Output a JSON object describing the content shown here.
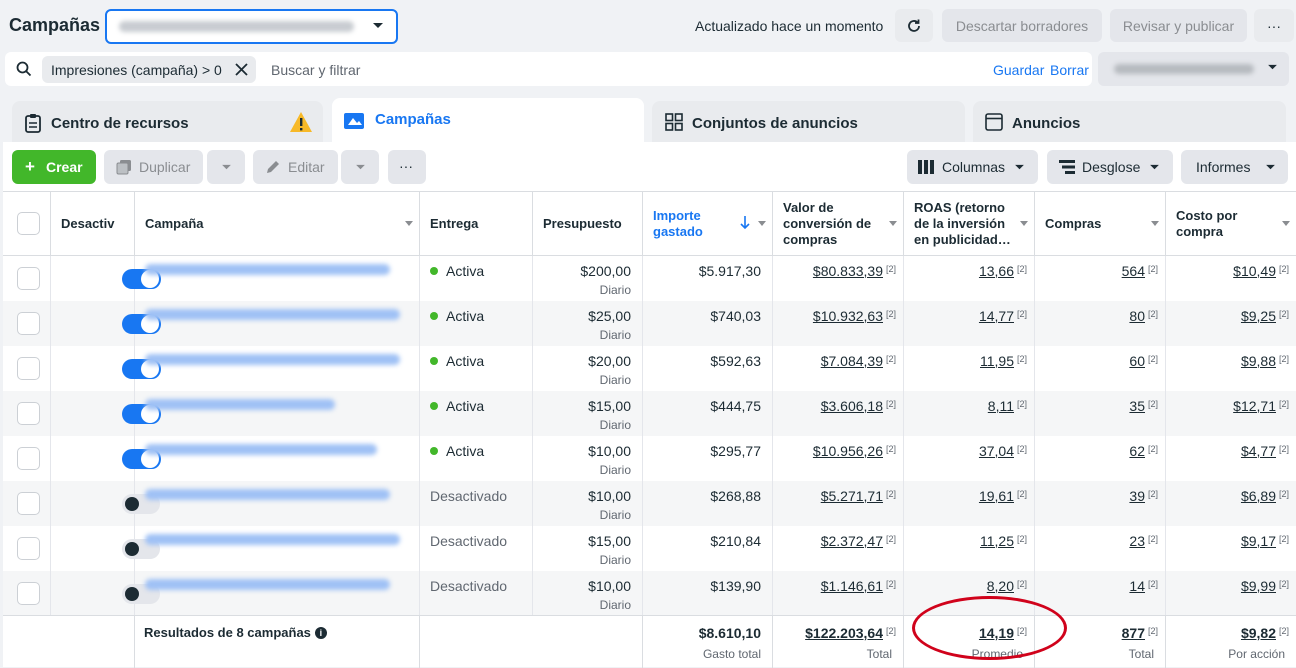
{
  "header": {
    "title": "Campañas",
    "updated": "Actualizado hace un momento",
    "discard_label": "Descartar borradores",
    "review_label": "Revisar y publicar",
    "more_label": "···"
  },
  "filter": {
    "chip": "Impresiones (campaña) > 0",
    "placeholder": "Buscar y filtrar",
    "save": "Guardar",
    "clear": "Borrar"
  },
  "tabs": [
    {
      "label": "Centro de recursos"
    },
    {
      "label": "Campañas"
    },
    {
      "label": "Conjuntos de anuncios"
    },
    {
      "label": "Anuncios"
    }
  ],
  "toolbar": {
    "create": "Crear",
    "duplicate": "Duplicar",
    "edit": "Editar",
    "more": "···",
    "columns": "Columnas",
    "breakdown": "Desglose",
    "reports": "Informes"
  },
  "columns": {
    "toggle": "Desactiv",
    "campaign": "Campaña",
    "delivery": "Entrega",
    "budget": "Presupuesto",
    "spent_1": "Importe",
    "spent_2": "gastado",
    "conv_1": "Valor de",
    "conv_2": "conversión de",
    "conv_3": "compras",
    "roas_1": "ROAS (retorno",
    "roas_2": "de la inversión",
    "roas_3": "en publicidad…",
    "purchases": "Compras",
    "cost_1": "Costo por",
    "cost_2": "compra"
  },
  "note_sup": "[2]",
  "rows": [
    {
      "on": true,
      "delivery": "Activa",
      "budget": "$200,00",
      "budget_sub": "Diario",
      "spent": "$5.917,30",
      "conv": "$80.833,39",
      "roas": "13,66",
      "purchases": "564",
      "cost": "$10,49"
    },
    {
      "on": true,
      "delivery": "Activa",
      "budget": "$25,00",
      "budget_sub": "Diario",
      "spent": "$740,03",
      "conv": "$10.932,63",
      "roas": "14,77",
      "purchases": "80",
      "cost": "$9,25"
    },
    {
      "on": true,
      "delivery": "Activa",
      "budget": "$20,00",
      "budget_sub": "Diario",
      "spent": "$592,63",
      "conv": "$7.084,39",
      "roas": "11,95",
      "purchases": "60",
      "cost": "$9,88"
    },
    {
      "on": true,
      "delivery": "Activa",
      "budget": "$15,00",
      "budget_sub": "Diario",
      "spent": "$444,75",
      "conv": "$3.606,18",
      "roas": "8,11",
      "purchases": "35",
      "cost": "$12,71"
    },
    {
      "on": true,
      "delivery": "Activa",
      "budget": "$10,00",
      "budget_sub": "Diario",
      "spent": "$295,77",
      "conv": "$10.956,26",
      "roas": "37,04",
      "purchases": "62",
      "cost": "$4,77"
    },
    {
      "on": false,
      "delivery": "Desactivado",
      "budget": "$10,00",
      "budget_sub": "Diario",
      "spent": "$268,88",
      "conv": "$5.271,71",
      "roas": "19,61",
      "purchases": "39",
      "cost": "$6,89"
    },
    {
      "on": false,
      "delivery": "Desactivado",
      "budget": "$15,00",
      "budget_sub": "Diario",
      "spent": "$210,84",
      "conv": "$2.372,47",
      "roas": "11,25",
      "purchases": "23",
      "cost": "$9,17"
    },
    {
      "on": false,
      "delivery": "Desactivado",
      "budget": "$10,00",
      "budget_sub": "Diario",
      "spent": "$139,90",
      "conv": "$1.146,61",
      "roas": "8,20",
      "purchases": "14",
      "cost": "$9,99"
    }
  ],
  "footer": {
    "title": "Resultados de 8 campañas",
    "spent": "$8.610,10",
    "spent_sub": "Gasto total",
    "conv": "$122.203,64",
    "conv_sub": "Total",
    "roas": "14,19",
    "roas_sub": "Promedio",
    "purchases": "877",
    "purchases_sub": "Total",
    "cost": "$9,82",
    "cost_sub": "Por acción"
  },
  "colors": {
    "accent": "#1877f2",
    "create": "#42b72a",
    "active_dot": "#42b72a",
    "warning": "#f7b928",
    "highlight_oval": "#d0021b"
  }
}
